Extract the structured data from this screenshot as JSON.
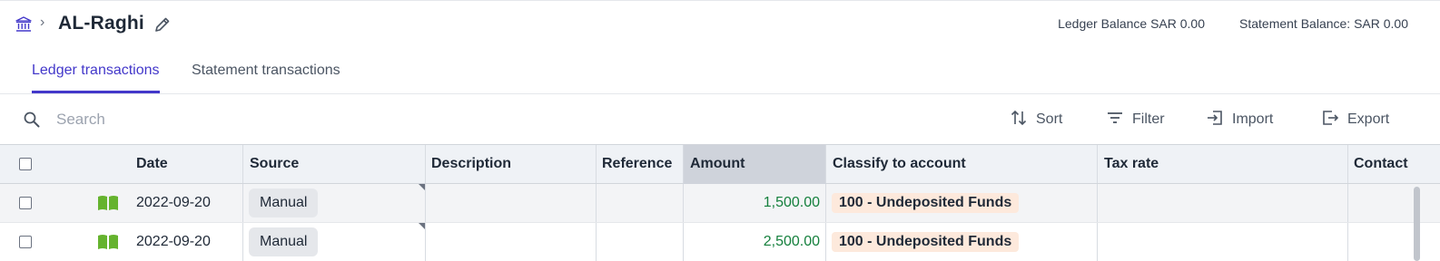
{
  "header": {
    "title": "AL-Raghi",
    "breadcrumb_separator": "›",
    "ledger_balance": "Ledger Balance SAR 0.00",
    "statement_balance": "Statement Balance: SAR 0.00"
  },
  "tabs": [
    {
      "label": "Ledger transactions",
      "active": true
    },
    {
      "label": "Statement transactions",
      "active": false
    }
  ],
  "toolbar": {
    "search_placeholder": "Search",
    "sort_label": "Sort",
    "filter_label": "Filter",
    "import_label": "Import",
    "export_label": "Export"
  },
  "table": {
    "columns": [
      "Date",
      "Source",
      "Description",
      "Reference",
      "Amount",
      "Classify to account",
      "Tax rate",
      "Contact"
    ],
    "rows": [
      {
        "date": "2022-09-20",
        "source": "Manual",
        "description": "",
        "reference": "",
        "amount": "1,500.00",
        "account": "100 - Undeposited Funds",
        "tax_rate": "",
        "contact": ""
      },
      {
        "date": "2022-09-20",
        "source": "Manual",
        "description": "",
        "reference": "",
        "amount": "2,500.00",
        "account": "100 - Undeposited Funds",
        "tax_rate": "",
        "contact": ""
      }
    ]
  },
  "colors": {
    "accent": "#4338ca",
    "amount_positive": "#15803d",
    "book_icon": "#65b32e",
    "account_badge_bg": "#fde9dc"
  },
  "icons": [
    "bank-icon",
    "pencil-icon",
    "search-icon",
    "sort-icon",
    "filter-icon",
    "import-icon",
    "export-icon",
    "book-icon"
  ]
}
